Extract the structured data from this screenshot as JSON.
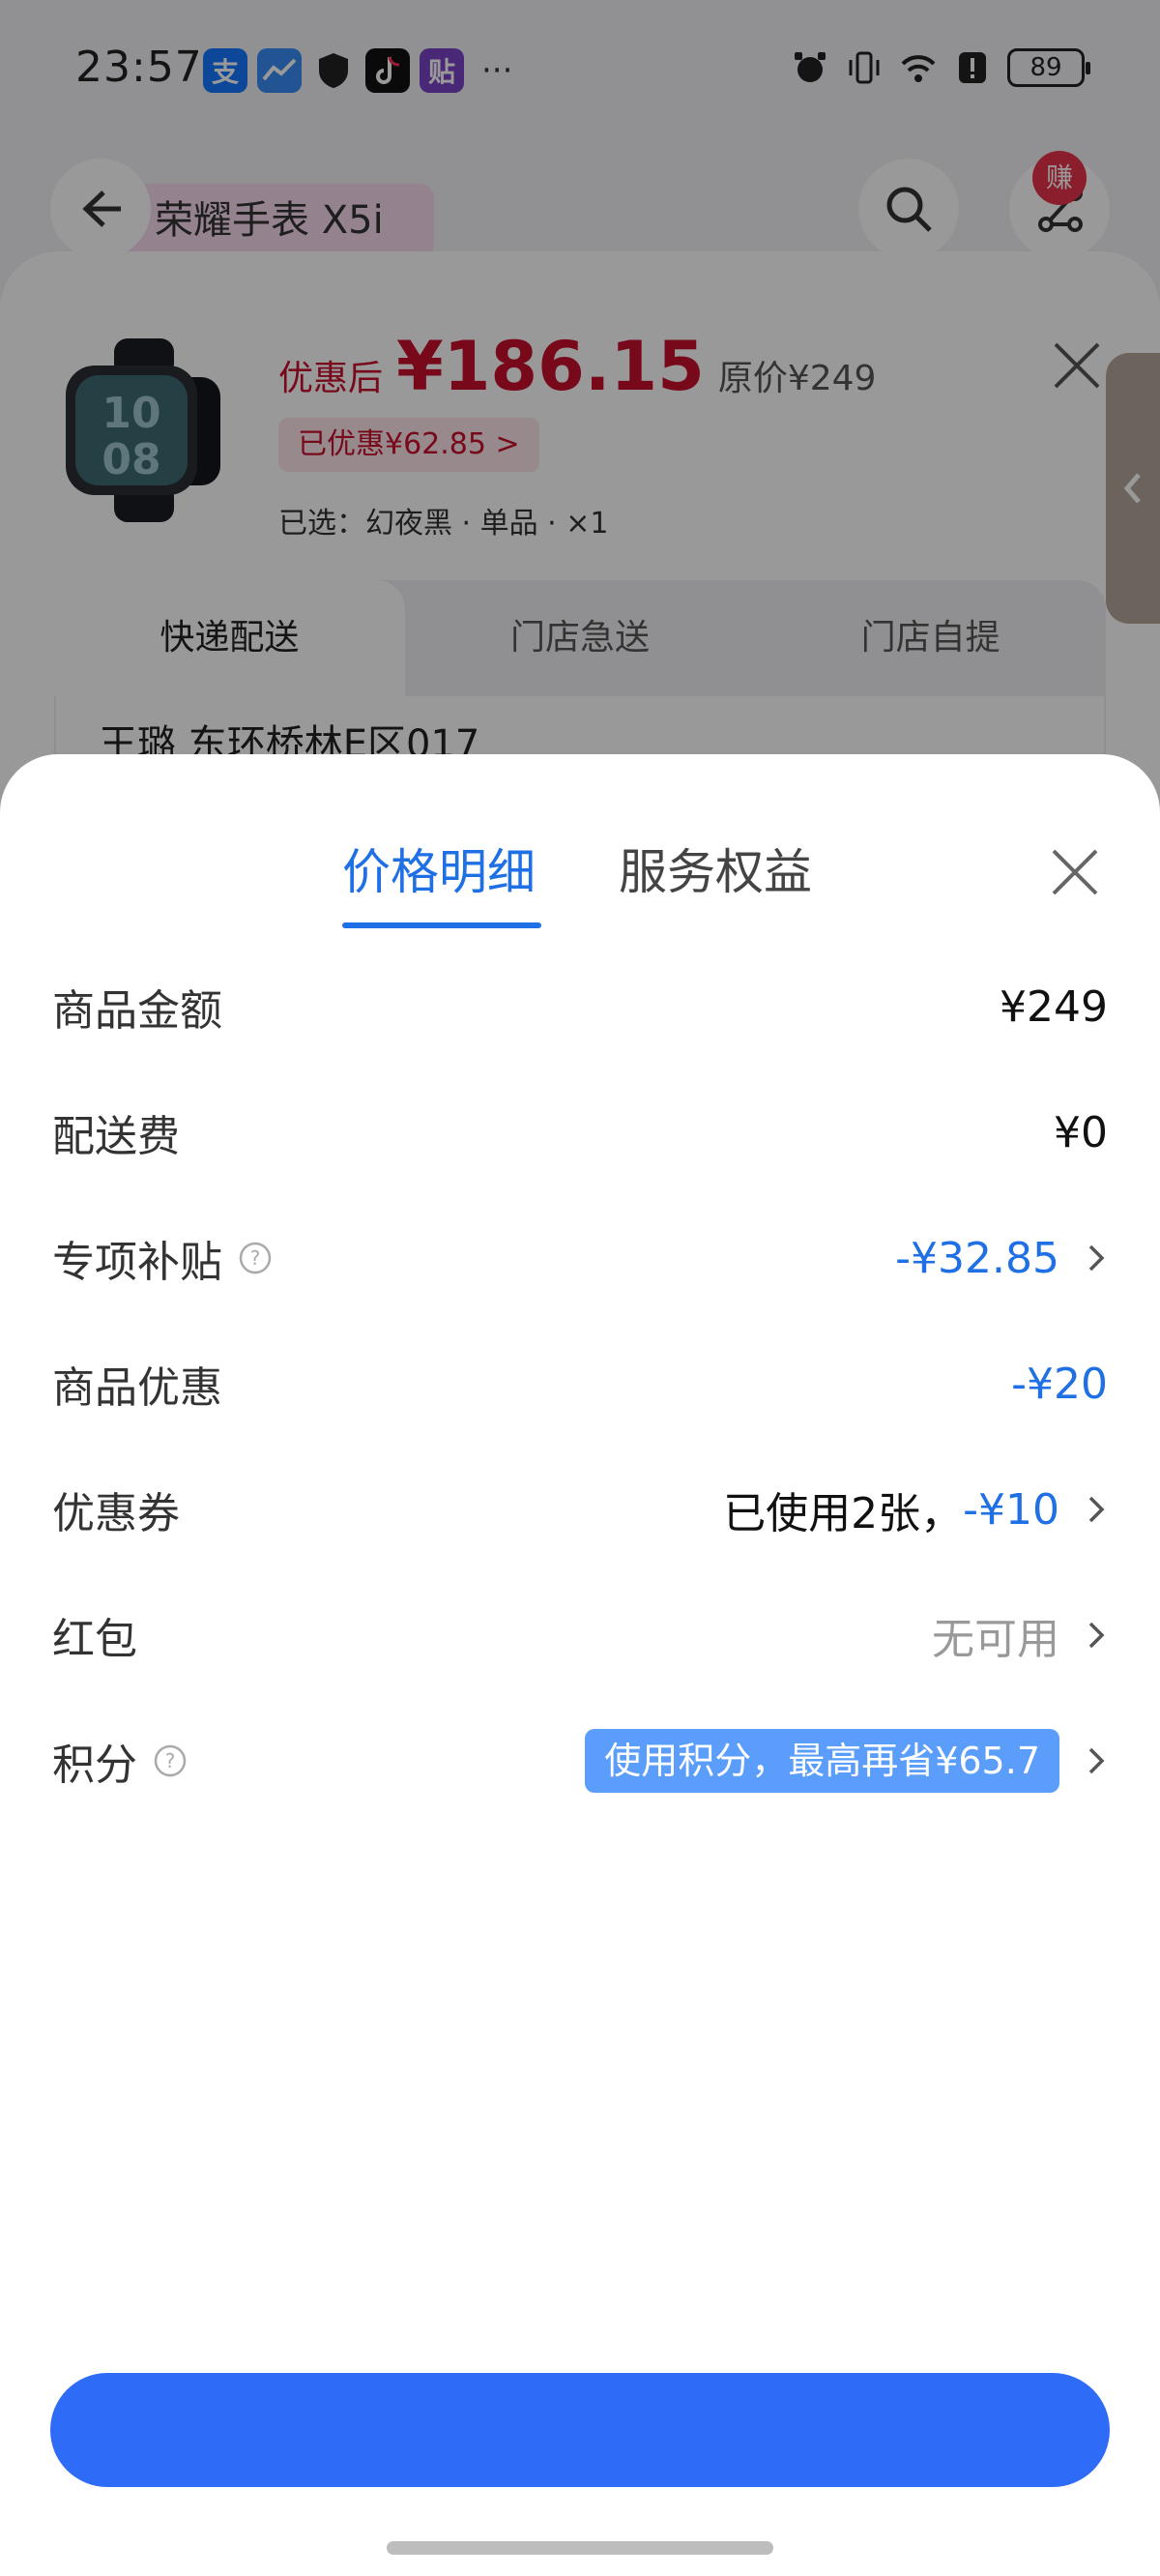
{
  "status_bar": {
    "time": "23:57",
    "apps": [
      {
        "icon": "alipay-icon",
        "glyph": "支",
        "color": "#1677ff"
      },
      {
        "icon": "stocks-app-icon",
        "glyph": "",
        "color": "#3a8df5"
      },
      {
        "icon": "shield-icon",
        "glyph": "",
        "color": "#222222"
      },
      {
        "icon": "tiktok-icon",
        "glyph": "",
        "color": "#111111"
      },
      {
        "icon": "tie-app-icon",
        "glyph": "贴",
        "color": "#7a44c9"
      }
    ],
    "more": "···",
    "battery": "89"
  },
  "nav": {
    "title": "荣耀手表 X5i",
    "earn_badge": "赚"
  },
  "product": {
    "after_label": "优惠后",
    "price": "¥186.15",
    "original_price": "原价¥249",
    "saved": "已优惠¥62.85 >",
    "selected": "已选：幻夜黑 · 单品 · ×1"
  },
  "delivery": {
    "tabs": [
      "快递配送",
      "门店急送",
      "门店自提"
    ],
    "active_index": 0,
    "address": "王璐  东环桥林E区017"
  },
  "price_sheet": {
    "tabs": [
      "价格明细",
      "服务权益"
    ],
    "active_index": 0,
    "rows": [
      {
        "label": "商品金额",
        "value": "¥249",
        "style": "dark",
        "help": false,
        "chevron": false
      },
      {
        "label": "配送费",
        "value": "¥0",
        "style": "dark",
        "help": false,
        "chevron": false
      },
      {
        "label": "专项补贴",
        "value": "-¥32.85",
        "style": "blue",
        "help": true,
        "chevron": true
      },
      {
        "label": "商品优惠",
        "value": "-¥20",
        "style": "blue",
        "help": false,
        "chevron": false
      },
      {
        "label": "优惠券",
        "value_prefix": "已使用2张，",
        "value": "-¥10",
        "style": "blue",
        "help": false,
        "chevron": true
      },
      {
        "label": "红包",
        "value": "无可用",
        "style": "gray",
        "help": false,
        "chevron": true
      },
      {
        "label": "积分",
        "value": "使用积分，最高再省¥65.7",
        "style": "pill",
        "help": true,
        "chevron": true
      }
    ],
    "confirm_button": ""
  },
  "colors": {
    "accent_blue": "#1f6fe5",
    "price_red": "#c8102e",
    "button_blue": "#2e6cf7"
  }
}
